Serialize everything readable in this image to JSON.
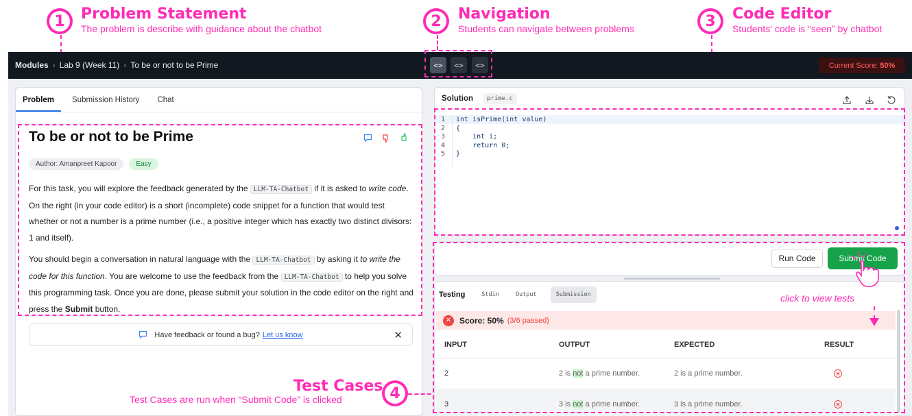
{
  "annotations": [
    {
      "num": "1",
      "title": "Problem Statement",
      "subtitle": "The problem is describe with guidance about the chatbot"
    },
    {
      "num": "2",
      "title": "Navigation",
      "subtitle": "Students can navigate between problems"
    },
    {
      "num": "3",
      "title": "Code Editor",
      "subtitle": "Students' code is “seen” by chatbot"
    },
    {
      "num": "4",
      "title": "Test Cases",
      "subtitle": "Test Cases are run when “Submit Code” is clicked"
    }
  ],
  "click_hint": "click to view tests",
  "topbar": {
    "breadcrumb": [
      "Modules",
      "Lab 9 (Week 11)",
      "To be or not to be Prime"
    ],
    "nav_buttons": [
      "<>",
      "<>",
      "<>"
    ],
    "score_label": "Current Score:",
    "score_value": "50%"
  },
  "left_panel": {
    "tabs": [
      "Problem",
      "Submission History",
      "Chat"
    ],
    "title": "To be or not to be Prime",
    "author": "Author: Amanpreet Kapoor",
    "difficulty": "Easy",
    "para1": {
      "t1": "For this task, you will explore the feedback generated by the ",
      "code1": "LLM-TA-Chatbot",
      "t2": " if it is asked to ",
      "em1": "write code",
      "t3": ". On the right (in your code editor) is a short (incomplete) code snippet for a function that would test whether or not a number is a prime number (i.e., a positive integer which has exactly two distinct divisors: 1 and itself)."
    },
    "para2": {
      "t1": "You should begin a conversation in natural language with the ",
      "code1": "LLM-TA-Chatbot",
      "t2": " by asking it ",
      "em1": "to write the code for this function",
      "t3": ". You are welcome to use the feedback from the ",
      "code2": "LLM-TA-Chatbot",
      "t4": " to help you solve this programming task. Once you are done, please submit your solution in the code editor on the right and press the ",
      "strong": "Submit",
      "t5": " button."
    },
    "feedback_text": "Have feedback or found a bug?",
    "feedback_link": "Let us know"
  },
  "editor": {
    "tab": "Solution",
    "filename": "prime.c",
    "lines": [
      {
        "n": "1",
        "code": "int isPrime(int value)"
      },
      {
        "n": "2",
        "code": "{"
      },
      {
        "n": "3",
        "code": "    int i;"
      },
      {
        "n": "4",
        "code": "    return 0;"
      },
      {
        "n": "5",
        "code": "}"
      }
    ],
    "run_label": "Run Code",
    "submit_label": "Submit Code"
  },
  "tests": {
    "tabs": [
      "Testing",
      "Stdin",
      "Output",
      "Submission"
    ],
    "score_text": "Score: 50%",
    "score_detail": "(3/6 passed)",
    "columns": [
      "INPUT",
      "OUTPUT",
      "EXPECTED",
      "RESULT"
    ],
    "rows": [
      {
        "input": "2",
        "out_pre": "2 is ",
        "out_hl": "not",
        "out_post": " a prime number.",
        "expected": "2 is a prime number.",
        "result": "fail"
      },
      {
        "input": "3",
        "out_pre": "3 is ",
        "out_hl": "not",
        "out_post": " a prime number.",
        "expected": "3 is a prime number.",
        "result": "fail"
      }
    ]
  },
  "colors": {
    "accent": "#ff2bb5",
    "submit": "#16a34a",
    "fail": "#ef4444"
  }
}
